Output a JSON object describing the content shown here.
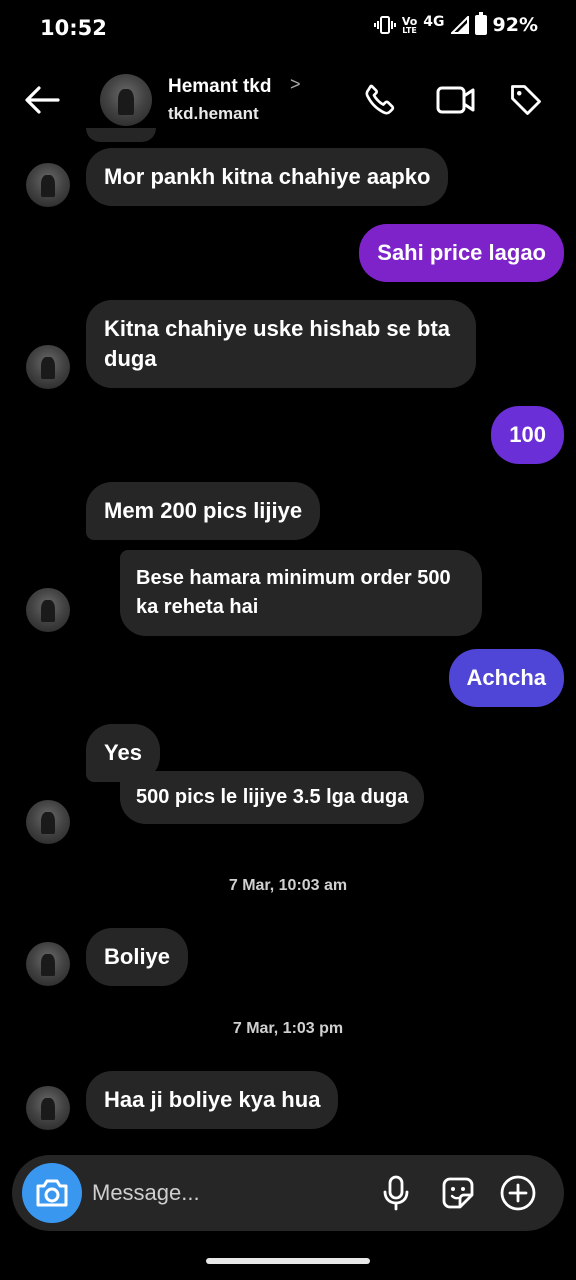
{
  "status": {
    "time": "10:52",
    "network_top": "Vo",
    "network_bottom": "LTE",
    "network_type": "4G",
    "battery": "92%"
  },
  "header": {
    "name": "Hemant tkd",
    "chevron": ">",
    "username": "tkd.hemant"
  },
  "messages": [
    {
      "dir": "in",
      "text": "Mor pankh kitna chahiye aapko"
    },
    {
      "dir": "out",
      "text": "Sahi price lagao"
    },
    {
      "dir": "in",
      "text": "Kitna chahiye uske hishab se bta duga"
    },
    {
      "dir": "out",
      "text": "100"
    },
    {
      "dir": "in",
      "text": "Mem 200 pics lijiye"
    },
    {
      "dir": "in",
      "text": "Bese hamara minimum order 500 ka reheta hai"
    },
    {
      "dir": "out",
      "text": "Achcha"
    },
    {
      "dir": "in",
      "text": "Yes"
    },
    {
      "dir": "in",
      "text": "500 pics le lijiye 3.5 lga duga"
    },
    {
      "dir": "in",
      "text": "Boliye"
    },
    {
      "dir": "in",
      "text": "Haa ji boliye kya hua"
    }
  ],
  "timestamps": [
    "7 Mar, 10:03 am",
    "7 Mar, 1:03 pm"
  ],
  "composer": {
    "placeholder": "Message..."
  },
  "icons": {
    "back": "arrow-left-icon",
    "call": "phone-icon",
    "video": "video-camera-icon",
    "tag": "tag-icon",
    "camera": "camera-icon",
    "mic": "microphone-icon",
    "sticker": "sticker-icon",
    "plus": "plus-circle-icon"
  },
  "colors": {
    "background": "#000000",
    "incoming_bubble": "#262626",
    "outgoing_purple": "#7e23c9",
    "outgoing_violet": "#6a2fd6",
    "outgoing_blue": "#4f45d6",
    "camera_button": "#3a97f0"
  }
}
